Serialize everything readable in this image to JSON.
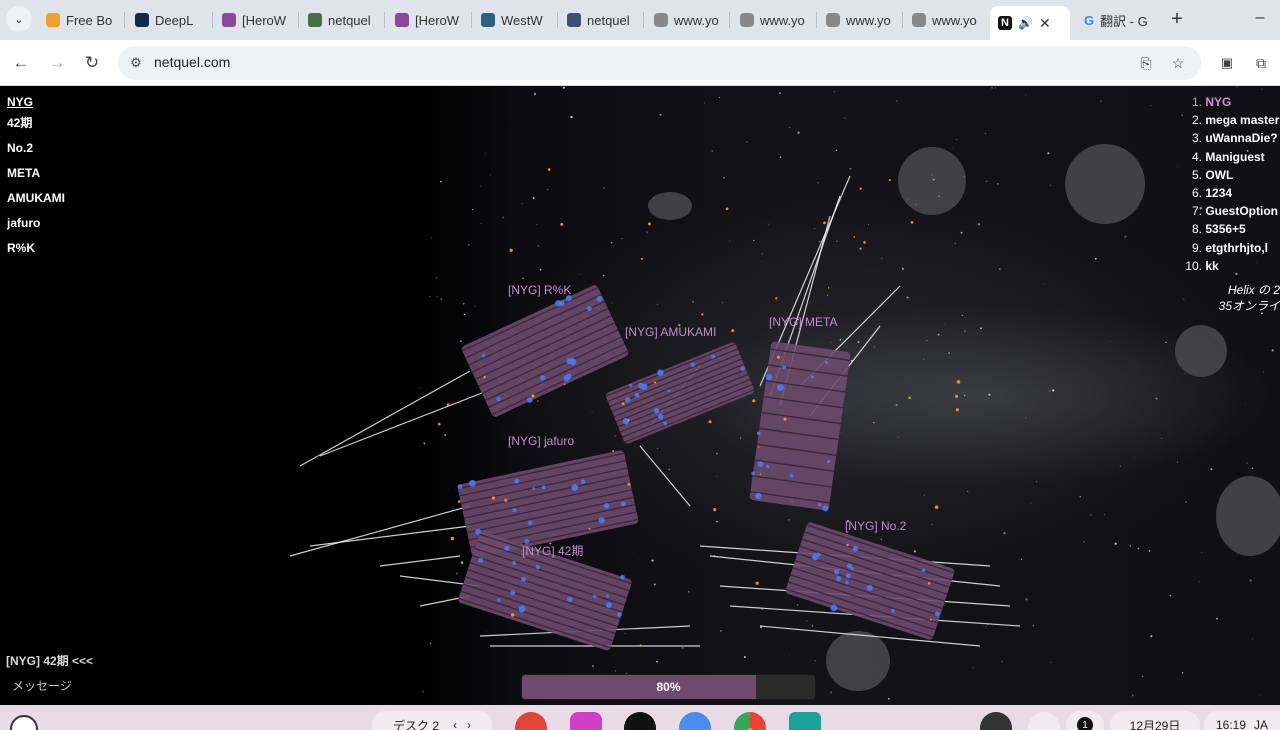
{
  "browser": {
    "tabs": [
      {
        "label": "Free Bo",
        "icon": "bolt-icon",
        "color": "#f0a030"
      },
      {
        "label": "DeepL",
        "icon": "deepl-icon",
        "color": "#0f2b46"
      },
      {
        "label": "[HeroW",
        "icon": "hero-icon",
        "color": "#8a4a9a"
      },
      {
        "label": "netquel",
        "icon": "game-icon",
        "color": "#4a7040"
      },
      {
        "label": "[HeroW",
        "icon": "hero-icon",
        "color": "#8a4a9a"
      },
      {
        "label": "WestW",
        "icon": "game-icon",
        "color": "#306080"
      },
      {
        "label": "netquel",
        "icon": "game-icon",
        "color": "#405070"
      },
      {
        "label": "www.yo",
        "icon": "youtube-icon",
        "color": "#888888"
      },
      {
        "label": "www.yo",
        "icon": "youtube-icon",
        "color": "#888888"
      },
      {
        "label": "www.yo",
        "icon": "youtube-icon",
        "color": "#888888"
      },
      {
        "label": "www.yo",
        "icon": "youtube-icon",
        "color": "#888888"
      }
    ],
    "active_tab": {
      "label": "N",
      "audio_icon": "speaker-icon",
      "close": "✕"
    },
    "last_tab": {
      "label": "翻訳 - G",
      "icon": "google-icon"
    },
    "new_tab": "+",
    "minimize": "–",
    "url": "netquel.com"
  },
  "hud": {
    "team_title": "NYG",
    "members": [
      "42期",
      "No.2",
      "META",
      "AMUKAMI",
      "jafuro",
      "R%K"
    ]
  },
  "leaderboard": [
    {
      "rank": "1.",
      "name": "NYG"
    },
    {
      "rank": "2.",
      "name": "mega master"
    },
    {
      "rank": "3.",
      "name": "uWannaDie?"
    },
    {
      "rank": "4.",
      "name": "Maniguest"
    },
    {
      "rank": "5.",
      "name": "OWL"
    },
    {
      "rank": "6.",
      "name": "1234"
    },
    {
      "rank": "7.",
      "name": "GuestOption"
    },
    {
      "rank": "8.",
      "name": "5356+5"
    },
    {
      "rank": "9.",
      "name": "etgthrhjto,l"
    },
    {
      "rank": "10.",
      "name": "kk"
    }
  ],
  "server": {
    "line1": "Helix の 2",
    "line2": "35オンライ"
  },
  "ship_labels": {
    "rk": "[NYG] R%K",
    "amukami": "[NYG] AMUKAMI",
    "meta": "[NYG] META",
    "jafuro": "[NYG] jafuro",
    "ki42": "[NYG] 42期",
    "no2": "[NYG] No.2"
  },
  "chat": {
    "last_message": "[NYG] 42期 <<<",
    "input_placeholder": "メッセージ"
  },
  "progress": {
    "value": 0.8,
    "label": "80%"
  },
  "shelf": {
    "desk_label": "デスク 2",
    "date": "12月29日",
    "time": "16:19",
    "lang": "JA",
    "notification_count": "1"
  },
  "colors": {
    "accent": "#c48ad0",
    "ship_hull": "#6e4a6e",
    "laser": "#ffffff",
    "engine": "#4a7cff"
  }
}
